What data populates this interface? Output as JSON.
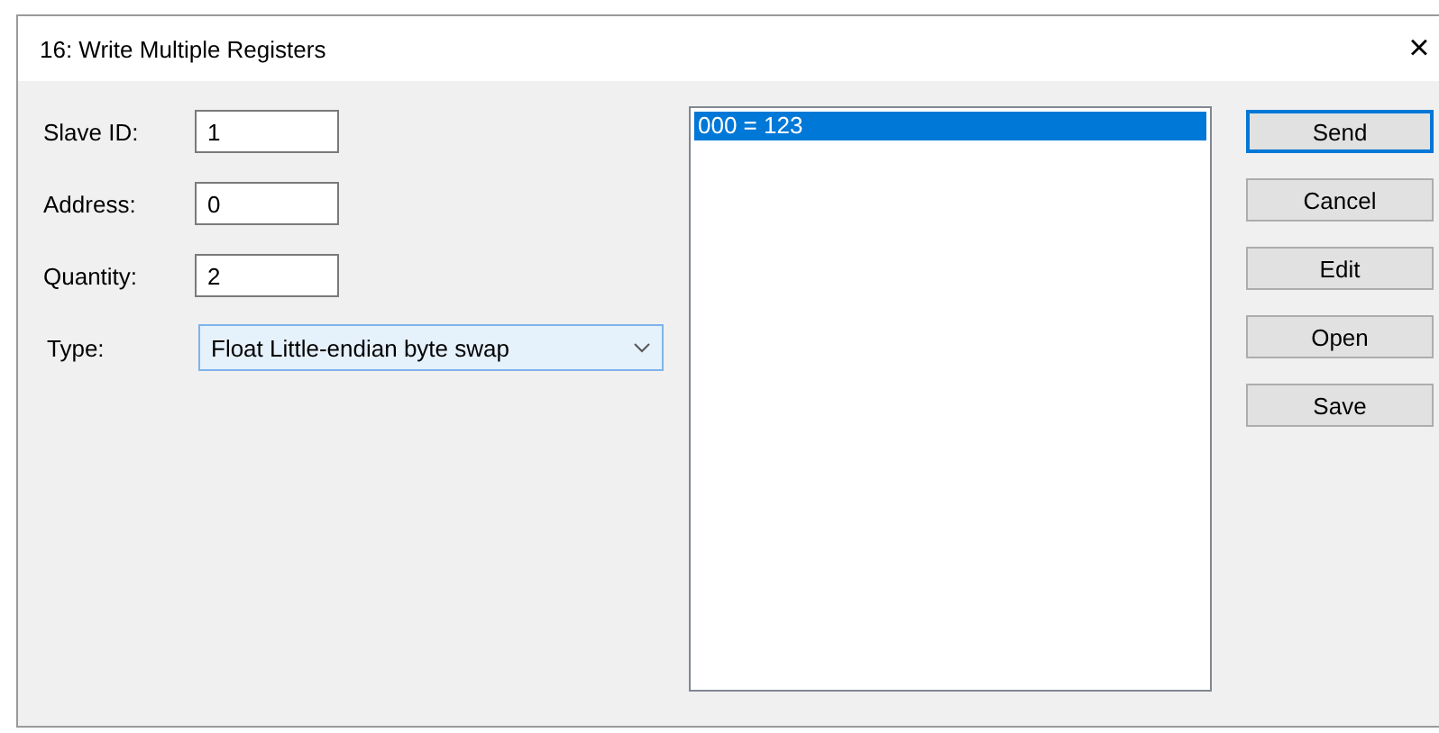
{
  "window": {
    "title": "16: Write Multiple Registers",
    "close": "×"
  },
  "fields": [
    {
      "label": "Slave ID:",
      "value": "1"
    },
    {
      "label": "Address:",
      "value": "0"
    },
    {
      "label": "Quantity:",
      "value": "2"
    }
  ],
  "type": {
    "label": "Type:",
    "value": "Float Little-endian byte swap"
  },
  "registers": [
    {
      "text": "000 = 123",
      "selected": true
    }
  ],
  "buttons": [
    {
      "label": "Send",
      "default": true
    },
    {
      "label": "Cancel",
      "default": false
    },
    {
      "label": "Edit",
      "default": false
    },
    {
      "label": "Open",
      "default": false
    },
    {
      "label": "Save",
      "default": false
    }
  ]
}
